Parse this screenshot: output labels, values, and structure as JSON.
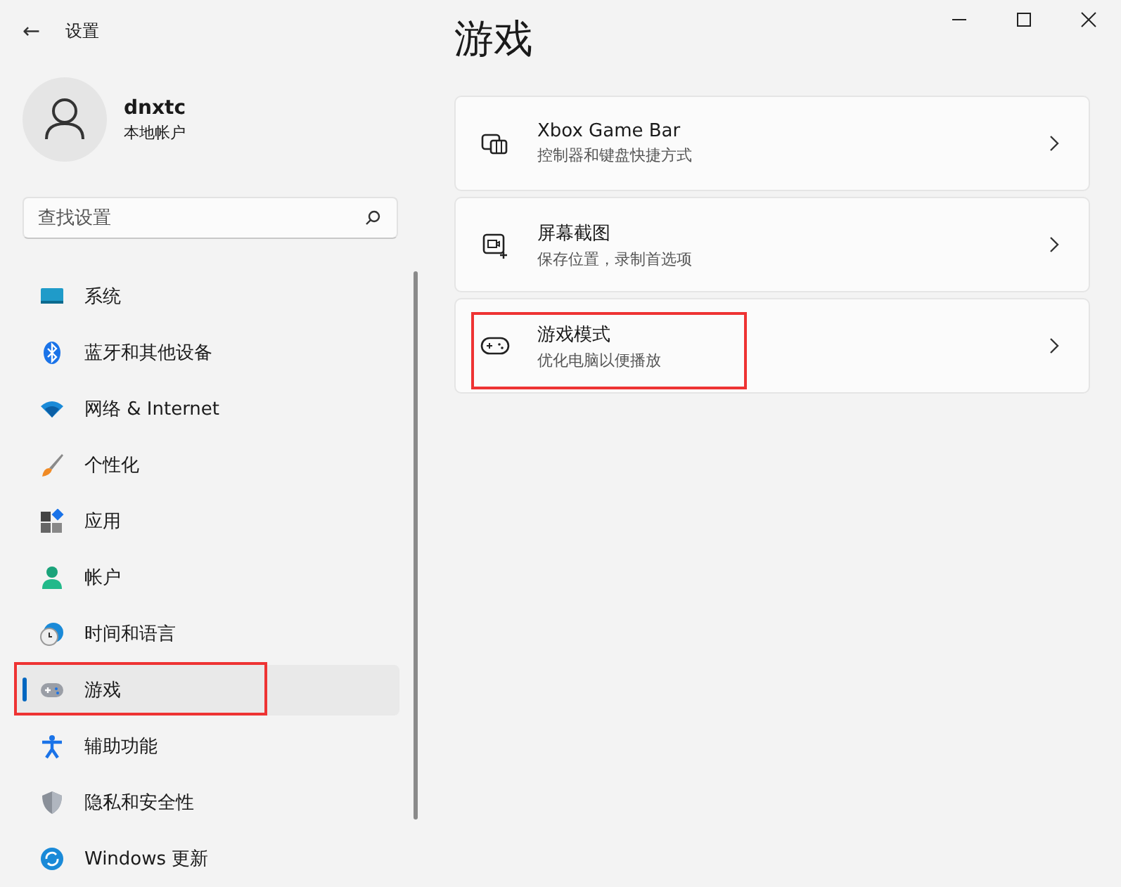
{
  "window": {
    "back_icon": "←",
    "title": "设置"
  },
  "account": {
    "name": "dnxtc",
    "type": "本地帐户"
  },
  "search": {
    "placeholder": "查找设置"
  },
  "sidebar": {
    "items": [
      {
        "label": "系统",
        "selected": false,
        "highlighted": false
      },
      {
        "label": "蓝牙和其他设备",
        "selected": false,
        "highlighted": false
      },
      {
        "label": "网络 & Internet",
        "selected": false,
        "highlighted": false
      },
      {
        "label": "个性化",
        "selected": false,
        "highlighted": false
      },
      {
        "label": "应用",
        "selected": false,
        "highlighted": false
      },
      {
        "label": "帐户",
        "selected": false,
        "highlighted": false
      },
      {
        "label": "时间和语言",
        "selected": false,
        "highlighted": false
      },
      {
        "label": "游戏",
        "selected": true,
        "highlighted": true
      },
      {
        "label": "辅助功能",
        "selected": false,
        "highlighted": false
      },
      {
        "label": "隐私和安全性",
        "selected": false,
        "highlighted": false
      },
      {
        "label": "Windows 更新",
        "selected": false,
        "highlighted": false
      }
    ]
  },
  "page": {
    "title": "游戏",
    "cards": [
      {
        "title": "Xbox Game Bar",
        "subtitle": "控制器和键盘快捷方式",
        "highlighted": false
      },
      {
        "title": "屏幕截图",
        "subtitle": "保存位置，录制首选项",
        "highlighted": false
      },
      {
        "title": "游戏模式",
        "subtitle": "优化电脑以便播放",
        "highlighted": true
      }
    ]
  }
}
